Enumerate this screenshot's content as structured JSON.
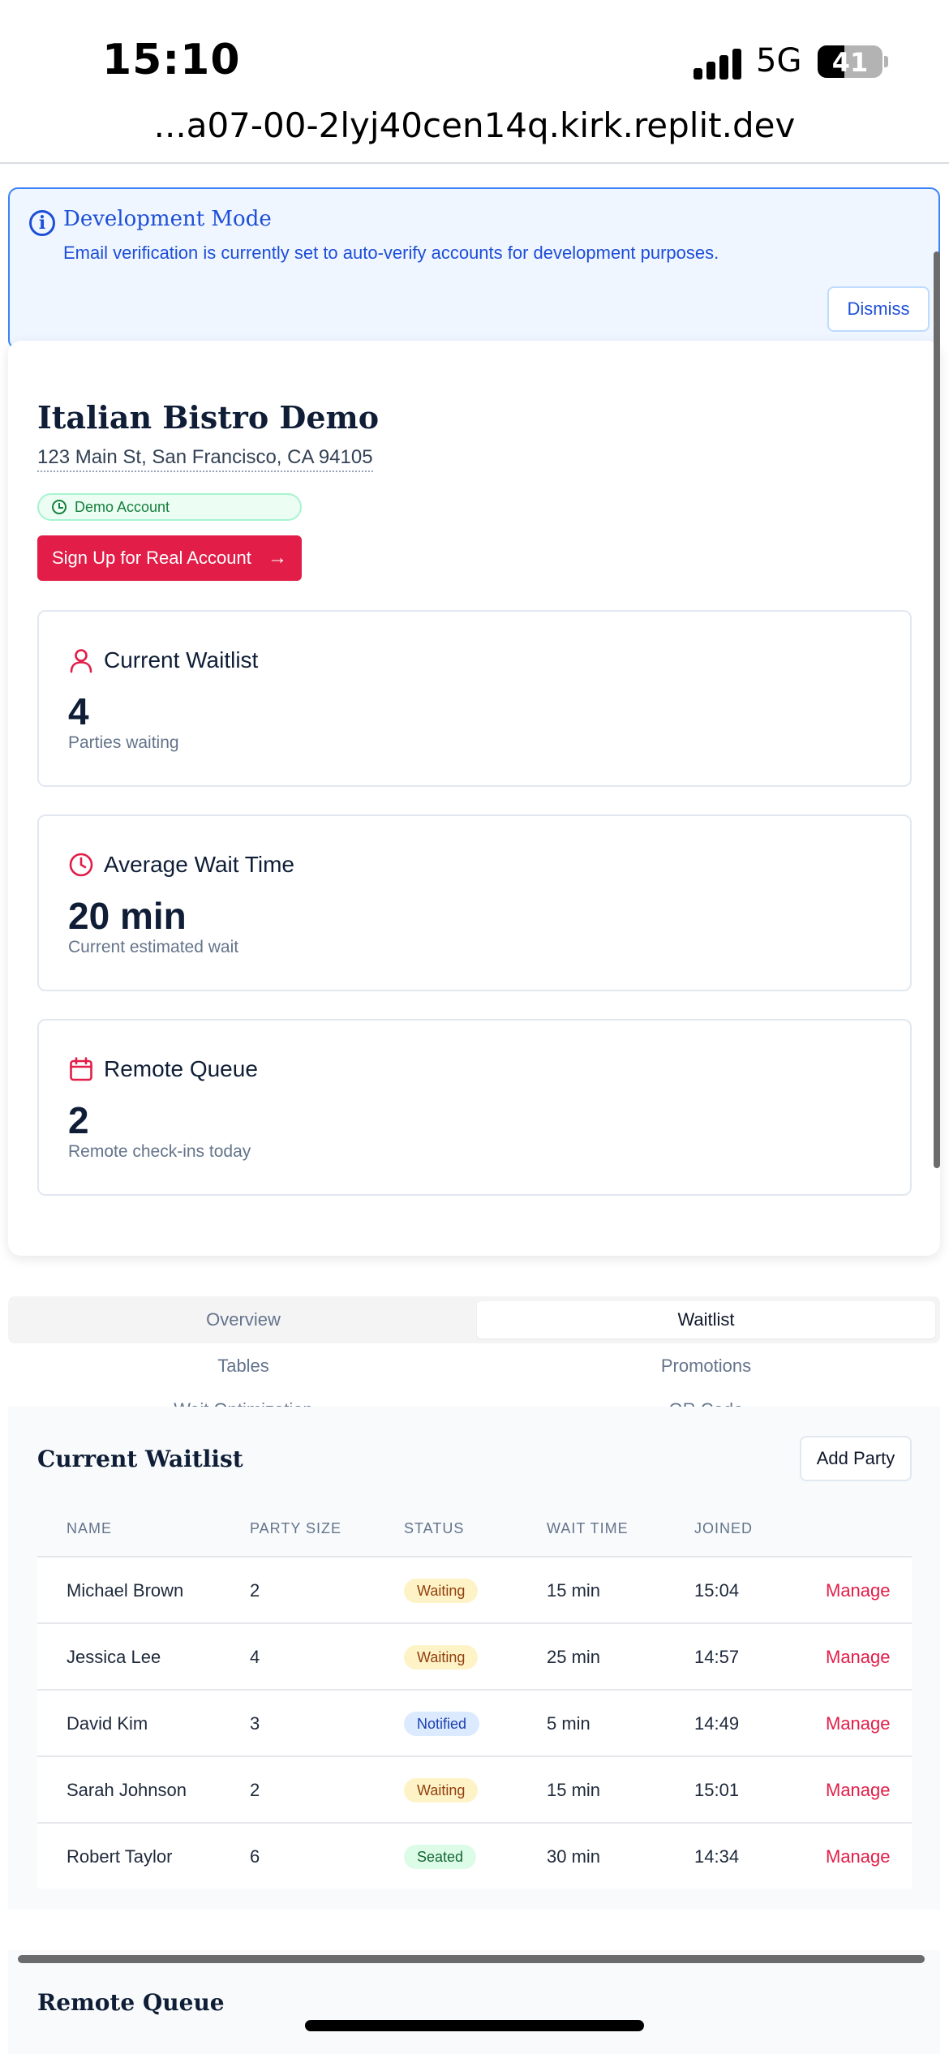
{
  "status_bar": {
    "time": "15:10",
    "network": "5G",
    "battery": "41",
    "battery_level": 0.41
  },
  "browser": {
    "url": "...a07-00-2lyj40cen14q.kirk.replit.dev"
  },
  "dev_banner": {
    "title": "Development Mode",
    "description": "Email verification is currently set to auto-verify accounts for development purposes.",
    "dismiss_label": "Dismiss"
  },
  "restaurant": {
    "name": "Italian Bistro Demo",
    "address": "123 Main St, San Francisco, CA 94105",
    "badge": "Demo Account",
    "signup_label": "Sign Up for Real Account"
  },
  "stats": [
    {
      "icon": "user-icon",
      "label": "Current Waitlist",
      "value": "4",
      "sub": "Parties waiting"
    },
    {
      "icon": "clock-icon",
      "label": "Average Wait Time",
      "value": "20 min",
      "sub": "Current estimated wait"
    },
    {
      "icon": "calendar-icon",
      "label": "Remote Queue",
      "value": "2",
      "sub": "Remote check-ins today"
    }
  ],
  "tabs": [
    "Overview",
    "Waitlist",
    "Tables",
    "Promotions",
    "Wait Optimization",
    "QR Code"
  ],
  "active_tab": "Waitlist",
  "waitlist": {
    "title": "Current Waitlist",
    "add_label": "Add Party",
    "columns": [
      "NAME",
      "PARTY SIZE",
      "STATUS",
      "WAIT TIME",
      "JOINED"
    ],
    "action_label": "Manage",
    "rows": [
      {
        "name": "Michael Brown",
        "size": "2",
        "status": "Waiting",
        "wait": "15 min",
        "joined": "15:04"
      },
      {
        "name": "Jessica Lee",
        "size": "4",
        "status": "Waiting",
        "wait": "25 min",
        "joined": "14:57"
      },
      {
        "name": "David Kim",
        "size": "3",
        "status": "Notified",
        "wait": "5 min",
        "joined": "14:49"
      },
      {
        "name": "Sarah Johnson",
        "size": "2",
        "status": "Waiting",
        "wait": "15 min",
        "joined": "15:01"
      },
      {
        "name": "Robert Taylor",
        "size": "6",
        "status": "Seated",
        "wait": "30 min",
        "joined": "14:34"
      }
    ]
  },
  "remote_queue": {
    "title": "Remote Queue"
  },
  "colors": {
    "accent": "#e11d48",
    "info": "#1d4ed8",
    "navy": "#0f1e36"
  }
}
